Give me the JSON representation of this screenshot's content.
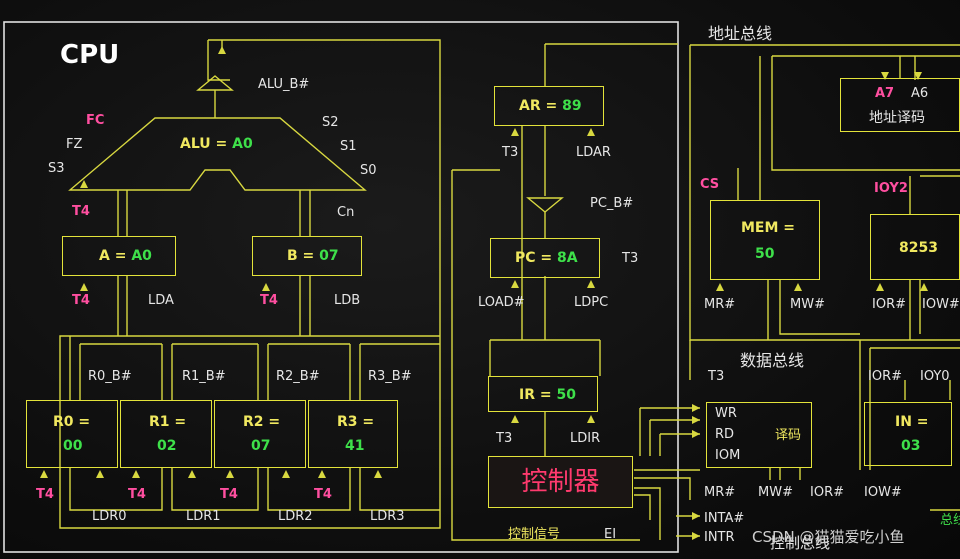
{
  "cpu_title": "CPU",
  "address_bus_label": "地址总线",
  "data_bus_label": "数据总线",
  "control_bus_label": "控制总线",
  "watermark": "CSDN @猫猫爱吃小鱼",
  "alu": {
    "name": "ALU = ",
    "value": "A0",
    "fc": "FC",
    "fz": "FZ",
    "s3": "S3",
    "s2": "S2",
    "s1": "S1",
    "s0": "S0",
    "cn": "Cn",
    "bus_label": "ALU_B#",
    "t4": "T4"
  },
  "reg_a": {
    "name": "A = ",
    "value": "A0",
    "t4": "T4",
    "load": "LDA"
  },
  "reg_b": {
    "name": "B = ",
    "value": "07",
    "t4": "T4",
    "load": "LDB"
  },
  "ar": {
    "name": "AR = ",
    "value": "89",
    "t3": "T3",
    "load": "LDAR"
  },
  "pc": {
    "name": "PC = ",
    "value": "8A",
    "t3": "T3",
    "load_hash": "LOAD#",
    "ldpc": "LDPC",
    "bus_label": "PC_B#"
  },
  "ir": {
    "name": "IR = ",
    "value": "50",
    "t3": "T3",
    "load": "LDIR"
  },
  "registers": [
    {
      "name": "R0 =",
      "value": "00",
      "bus": "R0_B#",
      "t4": "T4",
      "load": "LDR0"
    },
    {
      "name": "R1 =",
      "value": "02",
      "bus": "R1_B#",
      "t4": "T4",
      "load": "LDR1"
    },
    {
      "name": "R2 =",
      "value": "07",
      "bus": "R2_B#",
      "t4": "T4",
      "load": "LDR2"
    },
    {
      "name": "R3 =",
      "value": "41",
      "bus": "R3_B#",
      "t4": "T4",
      "load": "LDR3"
    }
  ],
  "controller": {
    "name": "控制器",
    "signals": "控制信号",
    "ei": "EI",
    "inta": "INTA#",
    "intr": "INTR"
  },
  "decoder_addr": {
    "a7": "A7",
    "a6": "A6",
    "name": "地址译码"
  },
  "mem": {
    "name": "MEM =",
    "value": "50",
    "cs": "CS",
    "mr": "MR#",
    "mw": "MW#"
  },
  "io8253": {
    "name": "8253",
    "ioy": "IOY2",
    "ior": "IOR#",
    "iow": "IOW#"
  },
  "decoder_io": {
    "wr": "WR",
    "rd": "RD",
    "iom": "IOM",
    "name": "译码",
    "t3": "T3",
    "mr": "MR#",
    "mw": "MW#",
    "ior": "IOR#",
    "iow": "IOW#"
  },
  "input": {
    "name": "IN =",
    "value": "03",
    "ior": "IOR#",
    "ioy0": "IOY0"
  },
  "right_edge_text": "总线"
}
